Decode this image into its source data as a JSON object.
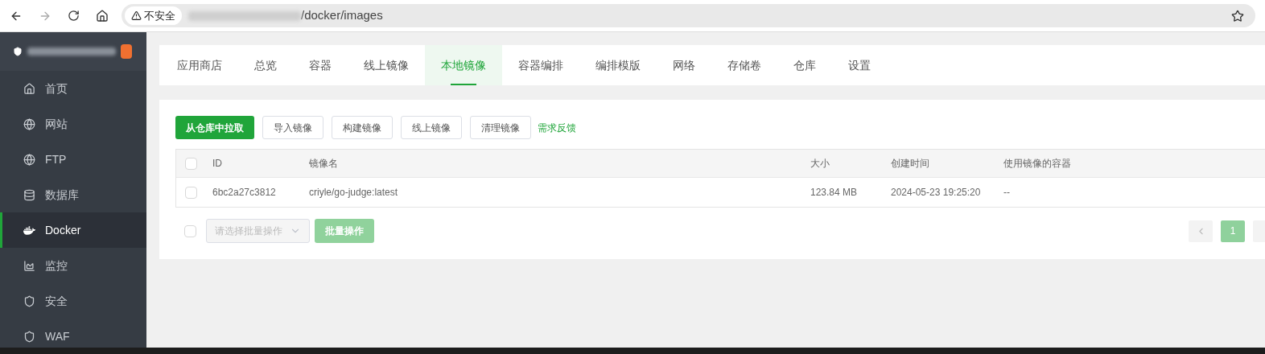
{
  "browser": {
    "security": "不安全",
    "url": "/docker/images"
  },
  "sidebar": {
    "items": [
      {
        "label": "首页",
        "kind": "home",
        "selected": false
      },
      {
        "label": "网站",
        "kind": "globe",
        "selected": false
      },
      {
        "label": "FTP",
        "kind": "ftp",
        "selected": false
      },
      {
        "label": "数据库",
        "kind": "database",
        "selected": false
      },
      {
        "label": "Docker",
        "kind": "docker",
        "selected": true
      },
      {
        "label": "监控",
        "kind": "monitor",
        "selected": false
      },
      {
        "label": "安全",
        "kind": "shield",
        "selected": false
      },
      {
        "label": "WAF",
        "kind": "waf",
        "selected": false
      }
    ]
  },
  "tabs": [
    {
      "label": "应用商店",
      "selected": false
    },
    {
      "label": "总览",
      "selected": false
    },
    {
      "label": "容器",
      "selected": false
    },
    {
      "label": "线上镜像",
      "selected": false
    },
    {
      "label": "本地镜像",
      "selected": true
    },
    {
      "label": "容器编排",
      "selected": false
    },
    {
      "label": "编排模版",
      "selected": false
    },
    {
      "label": "网络",
      "selected": false
    },
    {
      "label": "存储卷",
      "selected": false
    },
    {
      "label": "仓库",
      "selected": false
    },
    {
      "label": "设置",
      "selected": false
    }
  ],
  "toolbar": {
    "buttons": [
      {
        "label": "从仓库中拉取",
        "kind": "primary"
      },
      {
        "label": "导入镜像",
        "kind": "default"
      },
      {
        "label": "构建镜像",
        "kind": "default"
      },
      {
        "label": "线上镜像",
        "kind": "default"
      },
      {
        "label": "清理镜像",
        "kind": "default"
      }
    ],
    "link": "需求反馈"
  },
  "table": {
    "all_checked": false,
    "columns": [
      "ID",
      "镜像名",
      "大小",
      "创建时间",
      "使用镜像的容器"
    ],
    "rows": [
      {
        "checked": false,
        "cells": [
          "6bc2a27c3812",
          "criyle/go-judge:latest",
          "123.84 MB",
          "2024-05-23 19:25:20",
          "--"
        ]
      }
    ]
  },
  "footer": {
    "checked": false,
    "batch_placeholder": "请选择批量操作",
    "batch_button": "批量操作",
    "pages": [
      {
        "label": "1",
        "selected": true
      }
    ]
  }
}
